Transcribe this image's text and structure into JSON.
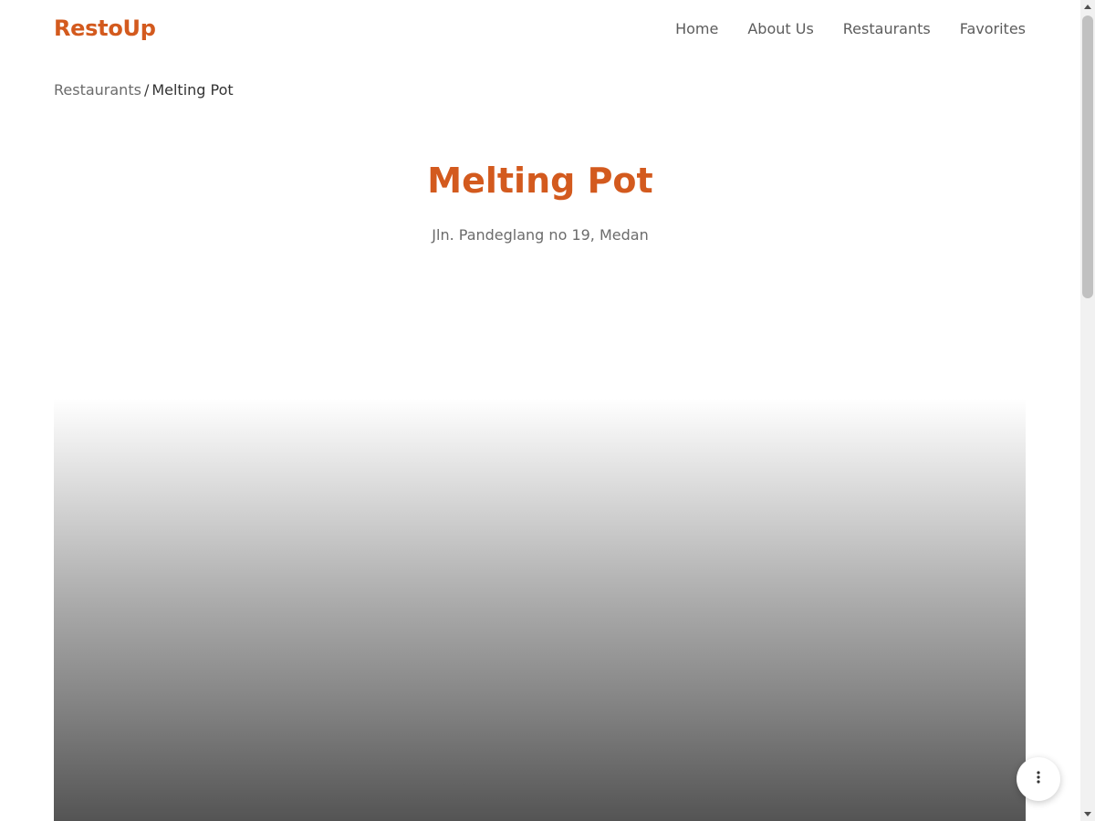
{
  "app": {
    "brand": "RestoUp",
    "accent_color": "#d35a1e"
  },
  "nav": {
    "items": [
      {
        "label": "Home"
      },
      {
        "label": "About Us"
      },
      {
        "label": "Restaurants"
      },
      {
        "label": "Favorites"
      }
    ]
  },
  "breadcrumb": {
    "parent": "Restaurants",
    "separator": "/",
    "current": "Melting Pot"
  },
  "restaurant": {
    "name": "Melting Pot",
    "address": "Jln. Pandeglang no 19, Medan"
  },
  "fab": {
    "icon": "more-vertical-icon"
  },
  "scrollbar": {
    "scroll_position": 0
  }
}
